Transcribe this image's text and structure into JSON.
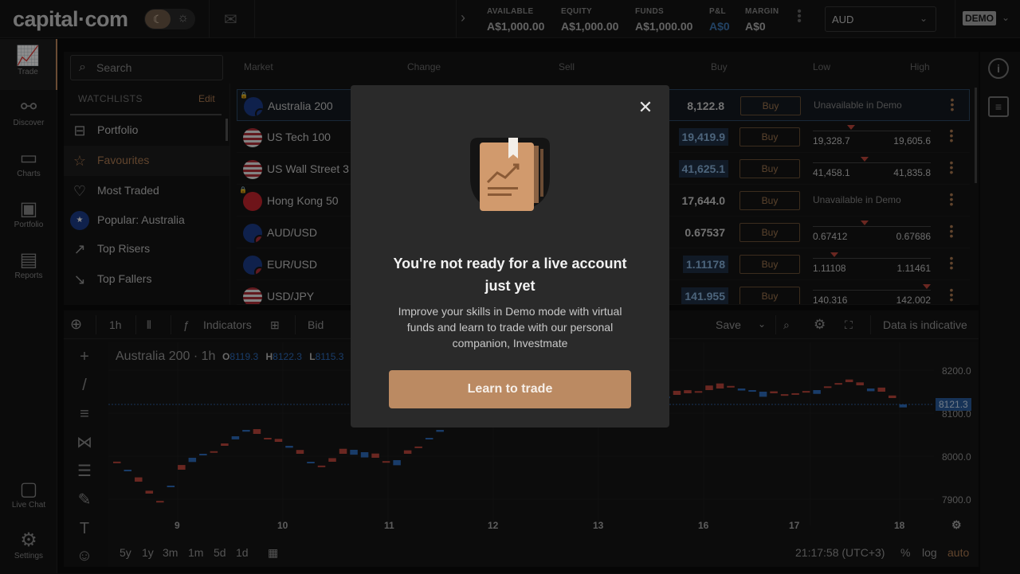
{
  "header": {
    "logo": "capital·com",
    "theme_moon": "☾",
    "theme_sun": "☼",
    "account": [
      {
        "label": "AVAILABLE",
        "value": "A$1,000.00"
      },
      {
        "label": "EQUITY",
        "value": "A$1,000.00"
      },
      {
        "label": "FUNDS",
        "value": "A$1,000.00"
      },
      {
        "label": "P&L",
        "value": "A$0"
      },
      {
        "label": "MARGIN",
        "value": "A$0"
      }
    ],
    "currency": "AUD",
    "mode_badge": "DEMO"
  },
  "sidebar": {
    "items": [
      {
        "label": "Trade",
        "icon": "trade-icon"
      },
      {
        "label": "Discover",
        "icon": "discover-icon"
      },
      {
        "label": "Charts",
        "icon": "charts-icon"
      },
      {
        "label": "Portfolio",
        "icon": "portfolio-icon"
      },
      {
        "label": "Reports",
        "icon": "reports-icon"
      }
    ],
    "bottom": [
      {
        "label": "Live Chat",
        "icon": "chat-icon"
      },
      {
        "label": "Settings",
        "icon": "gear-icon"
      }
    ]
  },
  "market": {
    "search_placeholder": "Search",
    "watchlists_label": "WATCHLISTS",
    "edit_label": "Edit",
    "watchlists": [
      "Portfolio",
      "Favourites",
      "Most Traded",
      "Popular: Australia",
      "Top Risers",
      "Top Fallers"
    ],
    "columns": [
      "Market",
      "Change",
      "Sell",
      "Buy",
      "Low",
      "High"
    ],
    "buy_label": "Buy",
    "rows": [
      {
        "name": "Australia 200",
        "price": "8,122.8",
        "low": "",
        "high": "",
        "unavailable": "Unavailable in Demo",
        "flag": "AU200",
        "locked": true
      },
      {
        "name": "US Tech 100",
        "price": "19,419.9",
        "low": "19,328.7",
        "high": "19,605.6",
        "unavailable": "",
        "flag": "US100",
        "locked": false
      },
      {
        "name": "US Wall Street 3",
        "price": "41,625.1",
        "low": "41,458.1",
        "high": "41,835.8",
        "unavailable": "",
        "flag": "US30",
        "locked": false
      },
      {
        "name": "Hong Kong 50",
        "price": "17,644.0",
        "low": "",
        "high": "",
        "unavailable": "Unavailable in Demo",
        "flag": "HK50",
        "locked": true
      },
      {
        "name": "AUD/USD",
        "price": "0.67537",
        "low": "0.67412",
        "high": "0.67686",
        "unavailable": "",
        "flag": "AUD",
        "locked": false
      },
      {
        "name": "EUR/USD",
        "price": "1.11178",
        "low": "1.11108",
        "high": "1.11461",
        "unavailable": "",
        "flag": "EUR",
        "locked": false
      },
      {
        "name": "USD/JPY",
        "price": "141.955",
        "low": "140.316",
        "high": "142.002",
        "unavailable": "",
        "flag": "USD",
        "locked": false
      }
    ]
  },
  "chart": {
    "toolbar": {
      "interval": "1h",
      "indicators": "Indicators",
      "price_type": "Bid",
      "save": "Save",
      "indicative": "Data is indicative"
    },
    "title": "Australia 200 · 1h",
    "ohlc": {
      "o_label": "O",
      "o": "8119.3",
      "h_label": "H",
      "h": "8122.3",
      "l_label": "L",
      "l": "8115.3"
    },
    "y_ticks": [
      "8200.0",
      "8100.0",
      "8000.0",
      "7900.0"
    ],
    "current_price_tag": "8121.3",
    "x_ticks": [
      "9",
      "10",
      "11",
      "12",
      "13",
      "16",
      "17",
      "18"
    ],
    "ranges": [
      "5y",
      "1y",
      "3m",
      "1m",
      "5d",
      "1d"
    ],
    "time": "21:17:58 (UTC+3)",
    "percent": "%",
    "log": "log",
    "auto": "auto"
  },
  "modal": {
    "title": "You're not ready for a live account just yet",
    "body": "Improve your skills in Demo mode with virtual funds and learn to trade with our personal companion, Investmate",
    "button": "Learn to trade"
  }
}
